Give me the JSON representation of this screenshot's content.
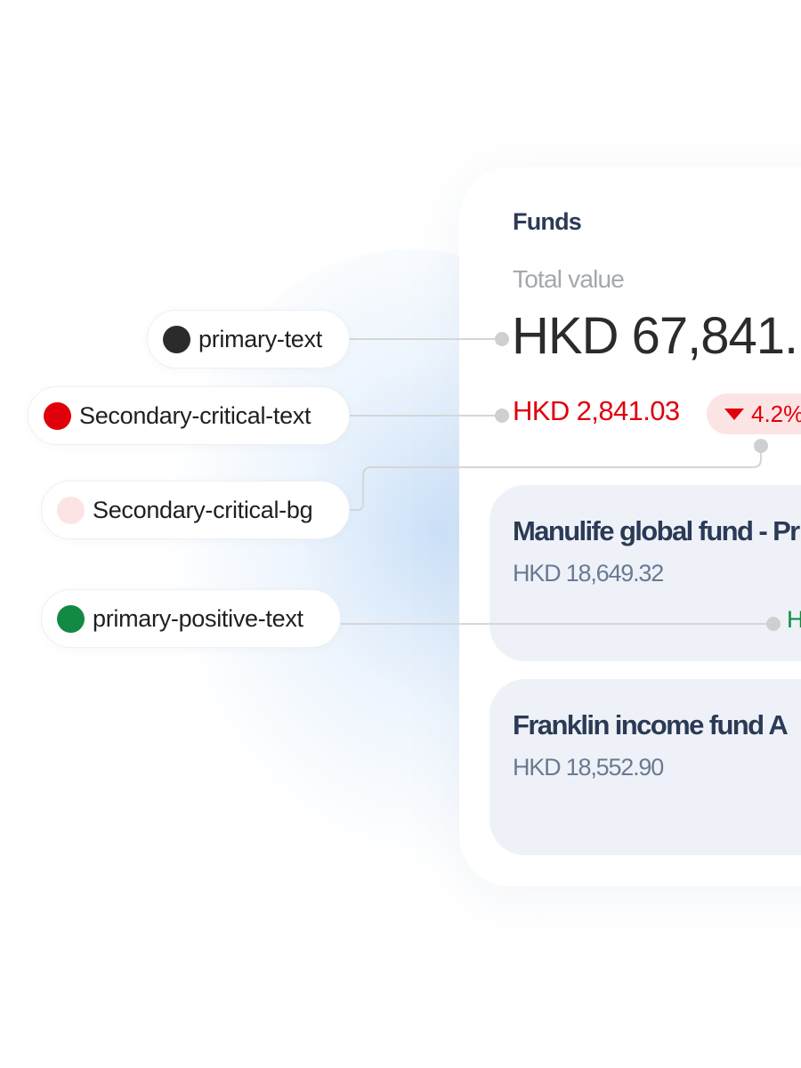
{
  "colors": {
    "primary_text": "#2b2b2b",
    "secondary_critical_text": "#e0000b",
    "secondary_critical_bg": "#fde4e4",
    "primary_positive_text": "#138a43",
    "heading_text": "#2b3a55",
    "muted_text": "#a4a8ae",
    "fund_card_bg": "#eef2f8",
    "connector_line": "#d6d6d6"
  },
  "tokens": [
    {
      "label": "primary-text",
      "swatch": "#2b2b2b"
    },
    {
      "label": "Secondary-critical-text",
      "swatch": "#e0000b"
    },
    {
      "label": "Secondary-critical-bg",
      "swatch": "#fde4e4"
    },
    {
      "label": "primary-positive-text",
      "swatch": "#138a43"
    }
  ],
  "card": {
    "title": "Funds",
    "total_label": "Total value",
    "total_value": "HKD 67,841.",
    "change_value": "HKD 2,841.03",
    "change_percent": "4.2%",
    "change_icon": "caret-down-icon",
    "funds": [
      {
        "name": "Manulife global fund - Pr",
        "value": "HKD 18,649.32",
        "gain": "H"
      },
      {
        "name": "Franklin income fund A",
        "value": "HKD 18,552.90",
        "gain": ""
      }
    ]
  }
}
